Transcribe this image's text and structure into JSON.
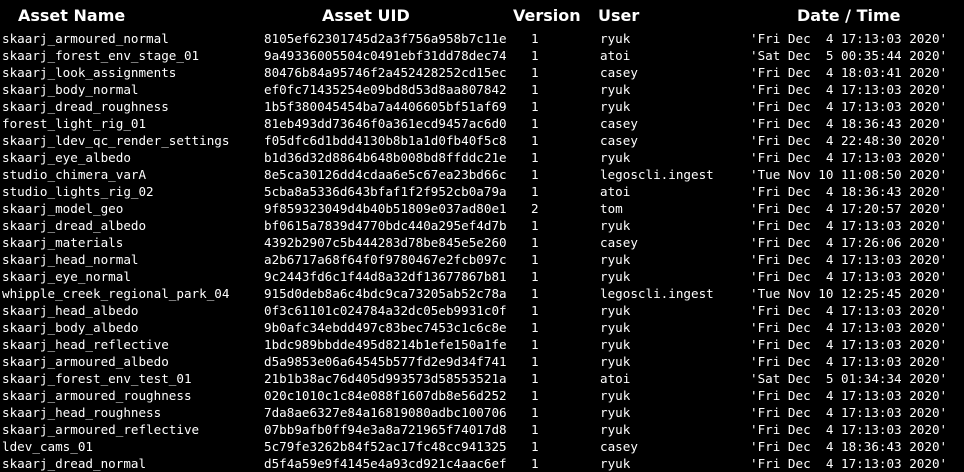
{
  "columns": {
    "name": "Asset Name",
    "uid": "Asset UID",
    "version": "Version",
    "user": "User",
    "date": "Date / Time"
  },
  "rows": [
    {
      "name": "skaarj_armoured_normal",
      "uid": "8105ef62301745d2a3f756a958b7c11e",
      "version": "1",
      "user": "ryuk",
      "date": "'Fri Dec  4 17:13:03 2020'"
    },
    {
      "name": "skaarj_forest_env_stage_01",
      "uid": "9a49336005504c0491ebf31dd78dec74",
      "version": "1",
      "user": "atoi",
      "date": "'Sat Dec  5 00:35:44 2020'"
    },
    {
      "name": "skaarj_look_assignments",
      "uid": "80476b84a95746f2a452428252cd15ec",
      "version": "1",
      "user": "casey",
      "date": "'Fri Dec  4 18:03:41 2020'"
    },
    {
      "name": "skaarj_body_normal",
      "uid": "ef0fc71435254e09bd8d53d8aa807842",
      "version": "1",
      "user": "ryuk",
      "date": "'Fri Dec  4 17:13:03 2020'"
    },
    {
      "name": "skaarj_dread_roughness",
      "uid": "1b5f380045454ba7a4406605bf51af69",
      "version": "1",
      "user": "ryuk",
      "date": "'Fri Dec  4 17:13:03 2020'"
    },
    {
      "name": "forest_light_rig_01",
      "uid": "81eb493dd73646f0a361ecd9457ac6d0",
      "version": "1",
      "user": "casey",
      "date": "'Fri Dec  4 18:36:43 2020'"
    },
    {
      "name": "skaarj_ldev_qc_render_settings",
      "uid": "f05dfc6d1bdd4130b8b1a1d0fb40f5c8",
      "version": "1",
      "user": "casey",
      "date": "'Fri Dec  4 22:48:30 2020'"
    },
    {
      "name": "skaarj_eye_albedo",
      "uid": "b1d36d32d8864b648b008bd8ffddc21e",
      "version": "1",
      "user": "ryuk",
      "date": "'Fri Dec  4 17:13:03 2020'"
    },
    {
      "name": "studio_chimera_varA",
      "uid": "8e5ca30126dd4cdaa6e5c67ea23bd66c",
      "version": "1",
      "user": "legoscli.ingest",
      "date": "'Tue Nov 10 11:08:50 2020'"
    },
    {
      "name": "studio_lights_rig_02",
      "uid": "5cba8a5336d643bfaf1f2f952cb0a79a",
      "version": "1",
      "user": "atoi",
      "date": "'Fri Dec  4 18:36:43 2020'"
    },
    {
      "name": "skaarj_model_geo",
      "uid": "9f859323049d4b40b51809e037ad80e1",
      "version": "2",
      "user": "tom",
      "date": "'Fri Dec  4 17:20:57 2020'"
    },
    {
      "name": "skaarj_dread_albedo",
      "uid": "bf0615a7839d4770bdc440a295ef4d7b",
      "version": "1",
      "user": "ryuk",
      "date": "'Fri Dec  4 17:13:03 2020'"
    },
    {
      "name": "skaarj_materials",
      "uid": "4392b2907c5b444283d78be845e5e260",
      "version": "1",
      "user": "casey",
      "date": "'Fri Dec  4 17:26:06 2020'"
    },
    {
      "name": "skaarj_head_normal",
      "uid": "a2b6717a68f64f0f9780467e2fcb097c",
      "version": "1",
      "user": "ryuk",
      "date": "'Fri Dec  4 17:13:03 2020'"
    },
    {
      "name": "skaarj_eye_normal",
      "uid": "9c2443fd6c1f44d8a32df13677867b81",
      "version": "1",
      "user": "ryuk",
      "date": "'Fri Dec  4 17:13:03 2020'"
    },
    {
      "name": "whipple_creek_regional_park_04",
      "uid": "915d0deb8a6c4bdc9ca73205ab52c78a",
      "version": "1",
      "user": "legoscli.ingest",
      "date": "'Tue Nov 10 12:25:45 2020'"
    },
    {
      "name": "skaarj_head_albedo",
      "uid": "0f3c61101c024784a32dc05eb9931c0f",
      "version": "1",
      "user": "ryuk",
      "date": "'Fri Dec  4 17:13:03 2020'"
    },
    {
      "name": "skaarj_body_albedo",
      "uid": "9b0afc34ebdd497c83bec7453c1c6c8e",
      "version": "1",
      "user": "ryuk",
      "date": "'Fri Dec  4 17:13:03 2020'"
    },
    {
      "name": "skaarj_head_reflective",
      "uid": "1bdc989bbdde495d8214b1efe150a1fe",
      "version": "1",
      "user": "ryuk",
      "date": "'Fri Dec  4 17:13:03 2020'"
    },
    {
      "name": "skaarj_armoured_albedo",
      "uid": "d5a9853e06a64545b577fd2e9d34f741",
      "version": "1",
      "user": "ryuk",
      "date": "'Fri Dec  4 17:13:03 2020'"
    },
    {
      "name": "skaarj_forest_env_test_01",
      "uid": "21b1b38ac76d405d993573d58553521a",
      "version": "1",
      "user": "atoi",
      "date": "'Sat Dec  5 01:34:34 2020'"
    },
    {
      "name": "skaarj_armoured_roughness",
      "uid": "020c1010c1c84e088f1607db8e56d252",
      "version": "1",
      "user": "ryuk",
      "date": "'Fri Dec  4 17:13:03 2020'"
    },
    {
      "name": "skaarj_head_roughness",
      "uid": "7da8ae6327e84a16819080adbc100706",
      "version": "1",
      "user": "ryuk",
      "date": "'Fri Dec  4 17:13:03 2020'"
    },
    {
      "name": "skaarj_armoured_reflective",
      "uid": "07bb9afb0ff94e3a8a721965f74017d8",
      "version": "1",
      "user": "ryuk",
      "date": "'Fri Dec  4 17:13:03 2020'"
    },
    {
      "name": "ldev_cams_01",
      "uid": "5c79fe3262b84f52ac17fc48cc941325",
      "version": "1",
      "user": "casey",
      "date": "'Fri Dec  4 18:36:43 2020'"
    },
    {
      "name": "skaarj_dread_normal",
      "uid": "d5f4a59e9f4145e4a93cd921c4aac6ef",
      "version": "1",
      "user": "ryuk",
      "date": "'Fri Dec  4 17:13:03 2020'"
    }
  ]
}
